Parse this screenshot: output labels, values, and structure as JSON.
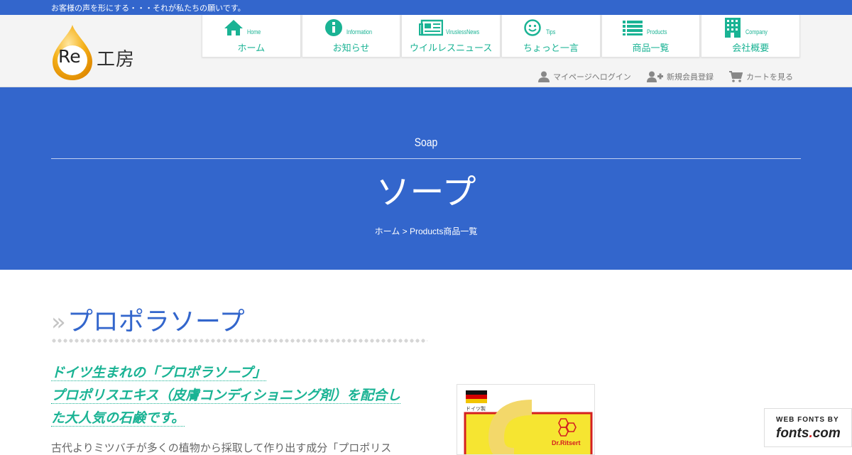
{
  "topbar": {
    "tagline": "お客様の声を形にする・・・それが私たちの願いです。"
  },
  "logo": {
    "re": "Re",
    "text": "工房"
  },
  "nav": [
    {
      "en": "Home",
      "jp": "ホーム",
      "icon": "home-icon"
    },
    {
      "en": "Information",
      "jp": "お知らせ",
      "icon": "info-icon"
    },
    {
      "en": "ViruslessNews",
      "jp": "ウイルレスニュース",
      "icon": "newspaper-icon"
    },
    {
      "en": "Tips",
      "jp": "ちょっと一言",
      "icon": "smile-icon"
    },
    {
      "en": "Products",
      "jp": "商品一覧",
      "icon": "list-icon"
    },
    {
      "en": "Company",
      "jp": "会社概要",
      "icon": "building-icon"
    }
  ],
  "util": {
    "login": "マイページへログイン",
    "register": "新規会員登録",
    "cart": "カートを見る"
  },
  "hero": {
    "en": "Soap",
    "title": "ソープ",
    "crumb": "ホーム > Products商品一覧"
  },
  "content": {
    "raquo": "»",
    "title": "プロポラソープ",
    "lead1": "ドイツ生まれの「プロポラソープ」",
    "lead2": "プロポリスエキス（皮膚コンディショニング剤）を配合し",
    "lead3": "た大人気の石鹸です。",
    "body": "古代よりミツバチが多くの植物から採取して作り出す成分「プロポリス"
  },
  "product": {
    "made": "ドイツ製",
    "brand": "Dr.Ritsert"
  },
  "badge": {
    "l1": "WEB FONTS BY",
    "l2a": "fonts",
    "l2dot": ".",
    "l2b": "com"
  },
  "colors": {
    "brand": "#3366cc",
    "accent": "#1ab394"
  }
}
